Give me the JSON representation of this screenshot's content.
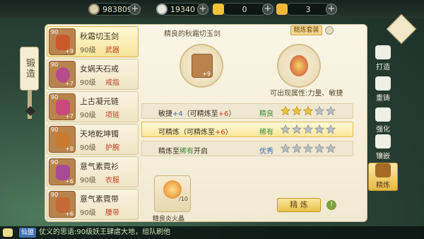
{
  "resources": [
    {
      "icon": "silver-coin-icon",
      "value": "983809"
    },
    {
      "icon": "copper-coin-icon",
      "value": "19340"
    },
    {
      "icon": "gold-ingot-icon",
      "value": "0"
    },
    {
      "icon": "gold-ingot-pile-icon",
      "value": "3"
    }
  ],
  "forge_tab": "锻造",
  "items": [
    {
      "level": "90",
      "plus": "+9",
      "name": "秋霜切玉剑",
      "lvl": "90级",
      "slot": "武器",
      "color": "#c9592a"
    },
    {
      "level": "90",
      "plus": "+7",
      "name": "女娲天石戒",
      "lvl": "90级",
      "slot": "戒指",
      "color": "#b54c8c"
    },
    {
      "level": "90",
      "plus": "+7",
      "name": "上古凝元链",
      "lvl": "90级",
      "slot": "项链",
      "color": "#c84a7b"
    },
    {
      "level": "90",
      "plus": "+8",
      "name": "天地乾坤镯",
      "lvl": "90级",
      "slot": "护腕",
      "color": "#c97a2f"
    },
    {
      "level": "90",
      "plus": "+6",
      "name": "意气素霓衫",
      "lvl": "90级",
      "slot": "衣服",
      "color": "#a94a95"
    },
    {
      "level": "90",
      "plus": "+6",
      "name": "意气素霓带",
      "lvl": "90级",
      "slot": "腰带",
      "color": "#c46a36"
    }
  ],
  "main": {
    "title": "精良的秋霜切玉剑",
    "badge": "精炼套装",
    "item_plus": "+9",
    "props_text": "可出现属性:力量、敏捷"
  },
  "rows": [
    {
      "label_a": "敏捷",
      "val": "+4",
      "label_b": "（可精炼至",
      "val2": "+6",
      "label_c": "）",
      "quality": "精良",
      "qcolor": "#3d8b3d",
      "stars": 3
    },
    {
      "label_a": "可精炼",
      "val": "",
      "label_b": "（可精炼至",
      "val2": "+6",
      "label_c": "）",
      "quality": "稀有",
      "qcolor": "#3d8b3d",
      "stars": 0
    },
    {
      "label_a": "精炼至",
      "val": "稀有",
      "label_b": "开启",
      "val2": "",
      "label_c": "",
      "quality": "优秀",
      "qcolor": "#3a6bb0",
      "stars": 0
    }
  ],
  "material": {
    "name": "精良炎火晶",
    "count": "/10"
  },
  "refine_button": "精  炼",
  "side_tabs": [
    {
      "label": "打造",
      "icon": "anvil-icon"
    },
    {
      "label": "重铸",
      "icon": "recast-icon"
    },
    {
      "label": "强化",
      "icon": "strengthen-icon"
    },
    {
      "label": "镶嵌",
      "icon": "inlay-icon"
    },
    {
      "label": "精炼",
      "icon": "refine-icon",
      "active": true
    }
  ],
  "chat": {
    "channel": "仙盟",
    "message": "仗义的思语:90级妖王肆虐大地，组队刷他"
  }
}
